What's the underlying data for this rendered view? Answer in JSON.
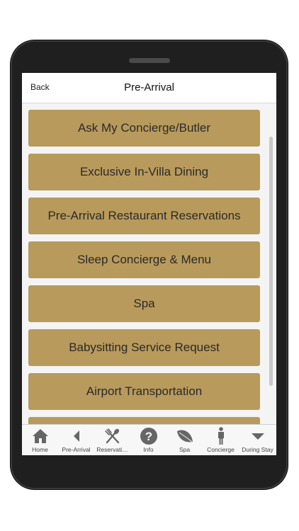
{
  "header": {
    "back_label": "Back",
    "title": "Pre-Arrival"
  },
  "menu": {
    "items": [
      {
        "label": "Ask My Concierge/Butler"
      },
      {
        "label": "Exclusive In-Villa Dining"
      },
      {
        "label": "Pre-Arrival Restaurant Reservations"
      },
      {
        "label": "Sleep Concierge & Menu"
      },
      {
        "label": "Spa"
      },
      {
        "label": "Babysitting Service Request"
      },
      {
        "label": "Airport Transportation"
      }
    ]
  },
  "tabs": [
    {
      "label": "Home",
      "icon": "home-icon"
    },
    {
      "label": "Pre-Arrival",
      "icon": "back-arrow-icon"
    },
    {
      "label": "Reservati…",
      "icon": "fork-knife-icon"
    },
    {
      "label": "Info",
      "icon": "question-icon"
    },
    {
      "label": "Spa",
      "icon": "leaf-icon"
    },
    {
      "label": "Concierge",
      "icon": "person-icon"
    },
    {
      "label": "During Stay",
      "icon": "triangle-down-icon"
    }
  ],
  "colors": {
    "accent": "#b89a5c",
    "frame": "#1f1f1f",
    "icon": "#666666"
  }
}
